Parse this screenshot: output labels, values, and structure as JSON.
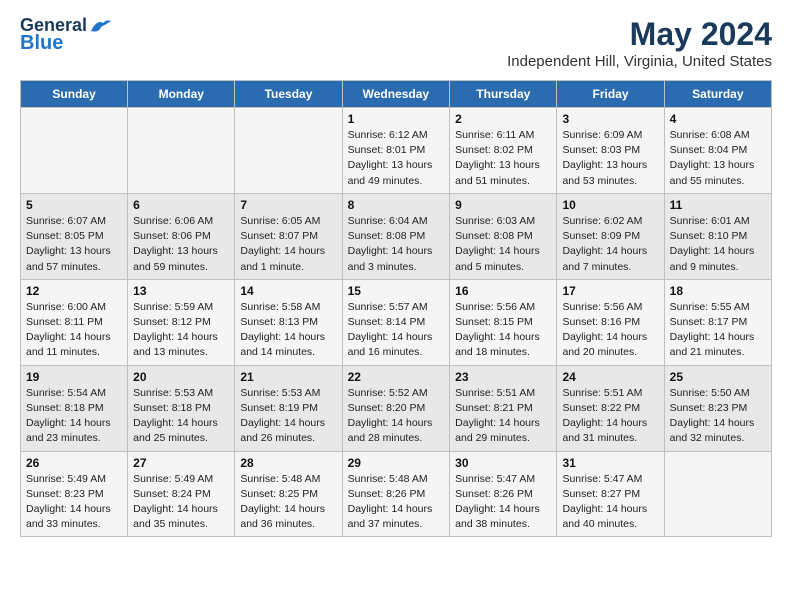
{
  "logo": {
    "line1": "General",
    "line2": "Blue"
  },
  "title": "May 2024",
  "subtitle": "Independent Hill, Virginia, United States",
  "weekdays": [
    "Sunday",
    "Monday",
    "Tuesday",
    "Wednesday",
    "Thursday",
    "Friday",
    "Saturday"
  ],
  "weeks": [
    [
      {
        "day": "",
        "info": ""
      },
      {
        "day": "",
        "info": ""
      },
      {
        "day": "",
        "info": ""
      },
      {
        "day": "1",
        "info": "Sunrise: 6:12 AM\nSunset: 8:01 PM\nDaylight: 13 hours\nand 49 minutes."
      },
      {
        "day": "2",
        "info": "Sunrise: 6:11 AM\nSunset: 8:02 PM\nDaylight: 13 hours\nand 51 minutes."
      },
      {
        "day": "3",
        "info": "Sunrise: 6:09 AM\nSunset: 8:03 PM\nDaylight: 13 hours\nand 53 minutes."
      },
      {
        "day": "4",
        "info": "Sunrise: 6:08 AM\nSunset: 8:04 PM\nDaylight: 13 hours\nand 55 minutes."
      }
    ],
    [
      {
        "day": "5",
        "info": "Sunrise: 6:07 AM\nSunset: 8:05 PM\nDaylight: 13 hours\nand 57 minutes."
      },
      {
        "day": "6",
        "info": "Sunrise: 6:06 AM\nSunset: 8:06 PM\nDaylight: 13 hours\nand 59 minutes."
      },
      {
        "day": "7",
        "info": "Sunrise: 6:05 AM\nSunset: 8:07 PM\nDaylight: 14 hours\nand 1 minute."
      },
      {
        "day": "8",
        "info": "Sunrise: 6:04 AM\nSunset: 8:08 PM\nDaylight: 14 hours\nand 3 minutes."
      },
      {
        "day": "9",
        "info": "Sunrise: 6:03 AM\nSunset: 8:08 PM\nDaylight: 14 hours\nand 5 minutes."
      },
      {
        "day": "10",
        "info": "Sunrise: 6:02 AM\nSunset: 8:09 PM\nDaylight: 14 hours\nand 7 minutes."
      },
      {
        "day": "11",
        "info": "Sunrise: 6:01 AM\nSunset: 8:10 PM\nDaylight: 14 hours\nand 9 minutes."
      }
    ],
    [
      {
        "day": "12",
        "info": "Sunrise: 6:00 AM\nSunset: 8:11 PM\nDaylight: 14 hours\nand 11 minutes."
      },
      {
        "day": "13",
        "info": "Sunrise: 5:59 AM\nSunset: 8:12 PM\nDaylight: 14 hours\nand 13 minutes."
      },
      {
        "day": "14",
        "info": "Sunrise: 5:58 AM\nSunset: 8:13 PM\nDaylight: 14 hours\nand 14 minutes."
      },
      {
        "day": "15",
        "info": "Sunrise: 5:57 AM\nSunset: 8:14 PM\nDaylight: 14 hours\nand 16 minutes."
      },
      {
        "day": "16",
        "info": "Sunrise: 5:56 AM\nSunset: 8:15 PM\nDaylight: 14 hours\nand 18 minutes."
      },
      {
        "day": "17",
        "info": "Sunrise: 5:56 AM\nSunset: 8:16 PM\nDaylight: 14 hours\nand 20 minutes."
      },
      {
        "day": "18",
        "info": "Sunrise: 5:55 AM\nSunset: 8:17 PM\nDaylight: 14 hours\nand 21 minutes."
      }
    ],
    [
      {
        "day": "19",
        "info": "Sunrise: 5:54 AM\nSunset: 8:18 PM\nDaylight: 14 hours\nand 23 minutes."
      },
      {
        "day": "20",
        "info": "Sunrise: 5:53 AM\nSunset: 8:18 PM\nDaylight: 14 hours\nand 25 minutes."
      },
      {
        "day": "21",
        "info": "Sunrise: 5:53 AM\nSunset: 8:19 PM\nDaylight: 14 hours\nand 26 minutes."
      },
      {
        "day": "22",
        "info": "Sunrise: 5:52 AM\nSunset: 8:20 PM\nDaylight: 14 hours\nand 28 minutes."
      },
      {
        "day": "23",
        "info": "Sunrise: 5:51 AM\nSunset: 8:21 PM\nDaylight: 14 hours\nand 29 minutes."
      },
      {
        "day": "24",
        "info": "Sunrise: 5:51 AM\nSunset: 8:22 PM\nDaylight: 14 hours\nand 31 minutes."
      },
      {
        "day": "25",
        "info": "Sunrise: 5:50 AM\nSunset: 8:23 PM\nDaylight: 14 hours\nand 32 minutes."
      }
    ],
    [
      {
        "day": "26",
        "info": "Sunrise: 5:49 AM\nSunset: 8:23 PM\nDaylight: 14 hours\nand 33 minutes."
      },
      {
        "day": "27",
        "info": "Sunrise: 5:49 AM\nSunset: 8:24 PM\nDaylight: 14 hours\nand 35 minutes."
      },
      {
        "day": "28",
        "info": "Sunrise: 5:48 AM\nSunset: 8:25 PM\nDaylight: 14 hours\nand 36 minutes."
      },
      {
        "day": "29",
        "info": "Sunrise: 5:48 AM\nSunset: 8:26 PM\nDaylight: 14 hours\nand 37 minutes."
      },
      {
        "day": "30",
        "info": "Sunrise: 5:47 AM\nSunset: 8:26 PM\nDaylight: 14 hours\nand 38 minutes."
      },
      {
        "day": "31",
        "info": "Sunrise: 5:47 AM\nSunset: 8:27 PM\nDaylight: 14 hours\nand 40 minutes."
      },
      {
        "day": "",
        "info": ""
      }
    ]
  ]
}
